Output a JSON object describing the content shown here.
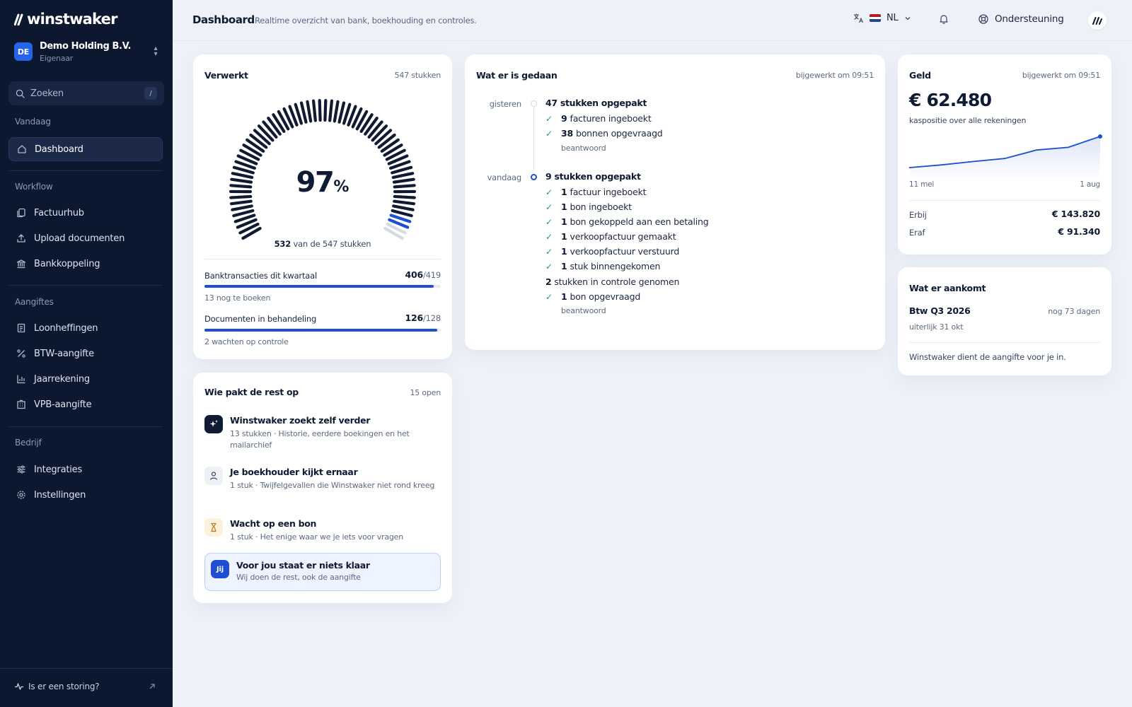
{
  "brand": "winstwaker",
  "org": {
    "avatar": "DE",
    "name": "Demo Holding B.V.",
    "role": "Eigenaar"
  },
  "search": {
    "label": "Zoeken",
    "shortcut": "/"
  },
  "sidebar": {
    "sections": [
      {
        "title": "Vandaag",
        "items": [
          {
            "label": "Dashboard",
            "icon": "home-icon",
            "active": true
          }
        ]
      },
      {
        "title": "Workflow",
        "items": [
          {
            "label": "Factuurhub",
            "icon": "files-icon"
          },
          {
            "label": "Upload documenten",
            "icon": "upload-icon"
          },
          {
            "label": "Bankkoppeling",
            "icon": "bank-icon"
          }
        ]
      },
      {
        "title": "Aangiftes",
        "items": [
          {
            "label": "Loonheffingen",
            "icon": "receipt-icon"
          },
          {
            "label": "BTW-aangifte",
            "icon": "percent-icon"
          },
          {
            "label": "Jaarrekening",
            "icon": "bar-chart-icon"
          },
          {
            "label": "VPB-aangifte",
            "icon": "building-icon"
          }
        ]
      },
      {
        "title": "Bedrijf",
        "items": [
          {
            "label": "Integraties",
            "icon": "sliders-icon"
          },
          {
            "label": "Instellingen",
            "icon": "gear-icon"
          }
        ]
      }
    ],
    "status_link": "Is er een storing?"
  },
  "topbar": {
    "title": "Dashboard",
    "subtitle": "Realtime overzicht van bank, boekhouding en controles.",
    "language": "NL",
    "support": "Ondersteuning"
  },
  "colors": {
    "accent": "#1d4fd0",
    "sidebar": "#0c1730",
    "success": "#1f9d6b"
  },
  "verwerkt": {
    "title": "Verwerkt",
    "meta": "547 stukken",
    "percent": "97",
    "percent_sign": "%",
    "processed": "532",
    "caption_rest": "van de 547 stukken",
    "gauge_fraction": 0.97,
    "bank": {
      "label": "Banktransacties dit kwartaal",
      "value": "406",
      "total": "/419",
      "fraction": 0.969,
      "sub": "13 nog te boeken"
    },
    "docs": {
      "label": "Documenten in behandeling",
      "value": "126",
      "total": "/128",
      "fraction": 0.984,
      "sub": "2 wachten op controle"
    }
  },
  "rest": {
    "title": "Wie pakt de rest op",
    "meta": "15 open",
    "tasks": [
      {
        "title": "Winstwaker zoekt zelf verder",
        "desc": "13 stukken · Historie, eerdere boekingen en het mailarchief",
        "icon": "sparkle-icon"
      },
      {
        "title": "Je boekhouder kijkt ernaar",
        "desc": "1 stuk · Twijfelgevallen die Winstwaker niet rond kreeg",
        "icon": "user-icon"
      },
      {
        "title": "Wacht op een bon",
        "desc": "1 stuk · Het enige waar we je iets voor vragen",
        "icon": "hourglass-icon"
      },
      {
        "title": "Voor jou staat er niets klaar",
        "desc": "Wij doen de rest, ook de aangifte",
        "badge": "Jij"
      }
    ]
  },
  "done": {
    "title": "Wat er is gedaan",
    "meta": "bijgewerkt om 09:51",
    "days": [
      {
        "day": "gisteren",
        "head": "47 stukken opgepakt",
        "items": [
          {
            "n": "9",
            "t": "facturen ingeboekt"
          },
          {
            "n": "38",
            "t": "bonnen opgevraagd"
          }
        ],
        "note": "beantwoord"
      },
      {
        "day": "vandaag",
        "head": "9 stukken opgepakt",
        "items": [
          {
            "n": "1",
            "t": "factuur ingeboekt"
          },
          {
            "n": "1",
            "t": "bon ingeboekt"
          },
          {
            "n": "1",
            "t": "bon gekoppeld aan een betaling"
          },
          {
            "n": "1",
            "t": "verkoopfactuur gemaakt"
          },
          {
            "n": "1",
            "t": "verkoopfactuur verstuurd"
          },
          {
            "n": "1",
            "t": "stuk binnengekomen"
          }
        ],
        "plain_n": "2",
        "plain": "stukken in controle genomen",
        "items2": [
          {
            "n": "1",
            "t": "bon opgevraagd"
          }
        ],
        "note": "beantwoord"
      }
    ]
  },
  "geld": {
    "title": "Geld",
    "meta": "bijgewerkt om 09:51",
    "amount": "€ 62.480",
    "amount_sub": "kaspositie over alle rekeningen",
    "x_start": "11 mei",
    "x_end": "1 aug",
    "in_label": "Erbij",
    "in_value": "€ 143.820",
    "out_label": "Eraf",
    "out_value": "€ 91.340"
  },
  "chart_data": {
    "type": "area",
    "xlabel": "",
    "ylabel": "",
    "x_ticks": [
      "11 mei",
      "1 aug"
    ],
    "series": [
      {
        "values": [
          0.08,
          0.16,
          0.26,
          0.35,
          0.6,
          0.68,
          1.0
        ]
      }
    ]
  },
  "aankomt": {
    "title": "Wat er aankomt",
    "name": "Btw Q3 2026",
    "days": "nog 73 dagen",
    "sub": "uiterlijk 31 okt",
    "note": "Winstwaker dient de aangifte voor je in."
  }
}
